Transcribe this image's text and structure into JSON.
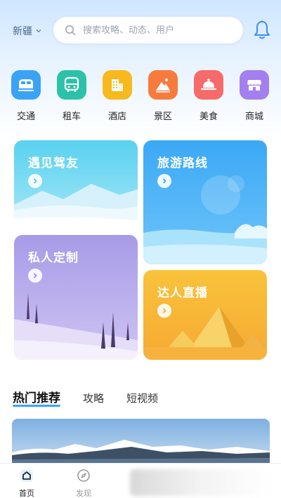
{
  "header": {
    "region": "新疆",
    "search_placeholder": "搜索攻略、动态、用户"
  },
  "categories": [
    {
      "label": "交通",
      "icon": "train-icon",
      "color": "#3aa3f5"
    },
    {
      "label": "租车",
      "icon": "bus-icon",
      "color": "#2cc2a7"
    },
    {
      "label": "酒店",
      "icon": "hotel-icon",
      "color": "#f7b91e"
    },
    {
      "label": "景区",
      "icon": "mountain-icon",
      "color": "#f77b3d"
    },
    {
      "label": "美食",
      "icon": "food-cloche-icon",
      "color": "#f76a6a"
    },
    {
      "label": "商城",
      "icon": "shop-icon",
      "color": "#a47ff0"
    }
  ],
  "cards": {
    "meet_driver": "遇见驾友",
    "travel_route": "旅游路线",
    "private_custom": "私人定制",
    "live_stream": "达人直播"
  },
  "tabs": [
    "热门推荐",
    "攻略",
    "短视频"
  ],
  "bottom_nav": {
    "home": "首页",
    "discover": "发现"
  }
}
